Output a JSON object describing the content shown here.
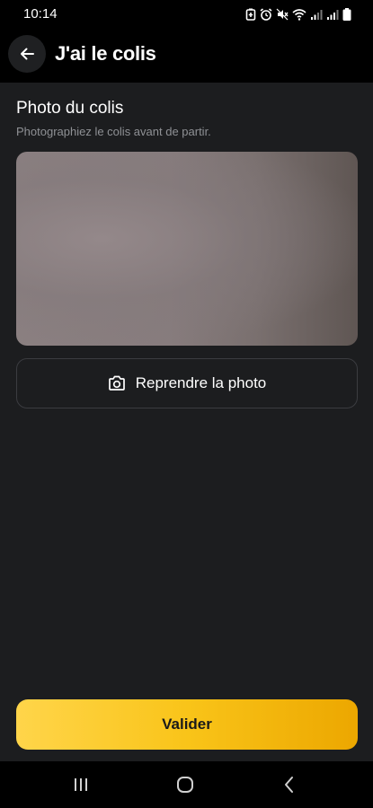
{
  "status_bar": {
    "time": "10:14",
    "icons": [
      "battery-saver-icon",
      "alarm-icon",
      "mute-icon",
      "wifi-icon",
      "signal-icon",
      "signal-icon",
      "battery-icon"
    ]
  },
  "header": {
    "title": "J'ai le colis",
    "back_icon": "arrow-left-icon"
  },
  "photo_section": {
    "title": "Photo du colis",
    "subtitle": "Photographiez le colis avant de partir."
  },
  "retake_button": {
    "label": "Reprendre la photo",
    "icon": "camera-icon"
  },
  "validate_button": {
    "label": "Valider"
  },
  "nav_bar": {
    "icons": [
      "recent-apps-icon",
      "home-icon",
      "back-icon"
    ]
  },
  "colors": {
    "background": "#1c1d1f",
    "header": "#000000",
    "accent_start": "#ffd54a",
    "accent_end": "#eca700",
    "subtitle_text": "#8f9195"
  }
}
